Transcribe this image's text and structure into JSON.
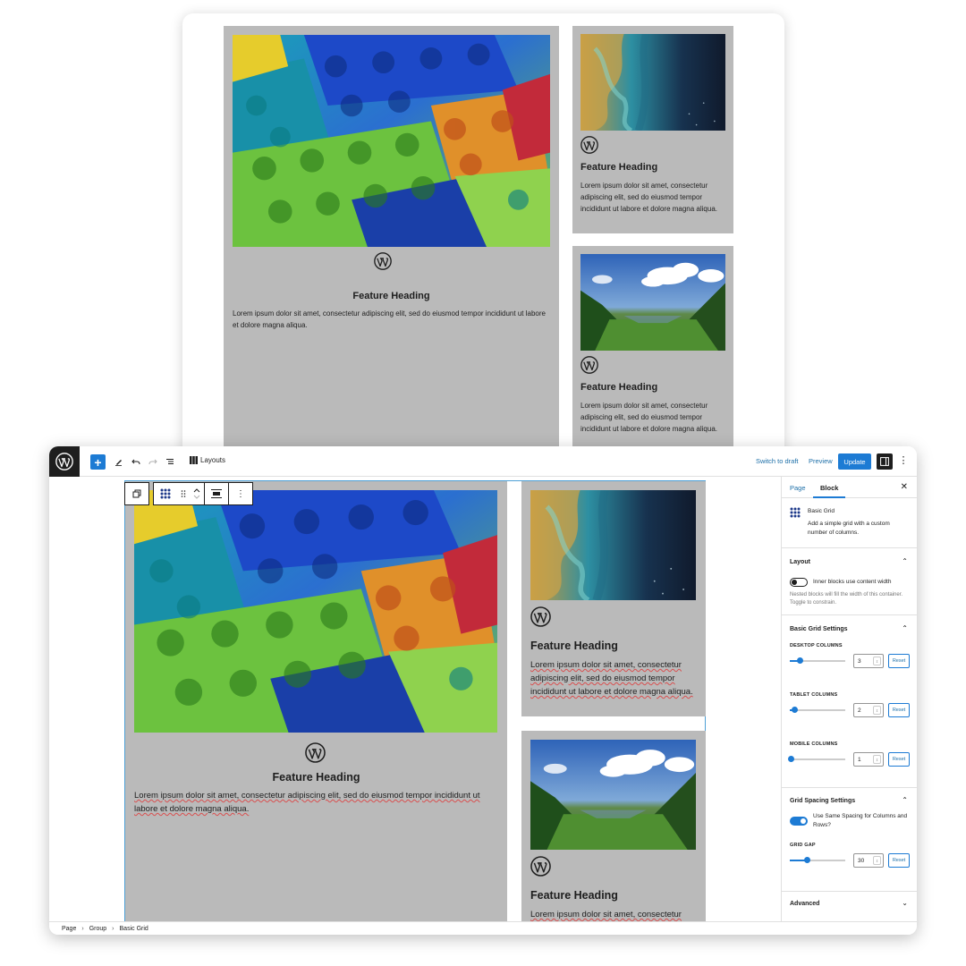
{
  "preview": {
    "main": {
      "heading": "Feature Heading",
      "body": "Lorem ipsum dolor sit amet, consectetur adipiscing elit, sed do eiusmod tempor incididunt ut labore et dolore magna aliqua."
    },
    "side1": {
      "heading": "Feature Heading",
      "body": "Lorem ipsum dolor sit amet, consectetur adipiscing elit, sed do eiusmod tempor incididunt ut labore et dolore magna aliqua."
    },
    "side2": {
      "heading": "Feature Heading",
      "body": "Lorem ipsum dolor sit amet, consectetur adipiscing elit, sed do eiusmod tempor incididunt ut labore et dolore magna aliqua."
    }
  },
  "topbar": {
    "add_label": "+",
    "layouts_label": "Layouts",
    "switch_to_draft": "Switch to draft",
    "preview": "Preview",
    "update": "Update"
  },
  "editor": {
    "main": {
      "heading": "Feature Heading",
      "body": "Lorem ipsum dolor sit amet, consectetur adipiscing elit, sed do eiusmod tempor incididunt ut labore et dolore magna aliqua."
    },
    "side1": {
      "heading": "Feature Heading",
      "body": "Lorem ipsum dolor sit amet, consectetur adipiscing elit, sed do eiusmod tempor incididunt ut labore et dolore magna aliqua."
    },
    "side2": {
      "heading": "Feature Heading",
      "body": "Lorem ipsum dolor sit amet, consectetur"
    }
  },
  "sidebar": {
    "tabs": [
      {
        "label": "Page"
      },
      {
        "label": "Block"
      }
    ],
    "block_name": "Basic Grid",
    "block_description": "Add a simple grid with a custom number of columns.",
    "layout": {
      "title": "Layout",
      "toggle_label": "Inner blocks use content width",
      "toggle_on": false,
      "help": "Nested blocks will fill the width of this container. Toggle to constrain."
    },
    "grid_settings": {
      "title": "Basic Grid Settings",
      "desktop_label": "DESKTOP COLUMNS",
      "desktop_value": "3",
      "tablet_label": "TABLET COLUMNS",
      "tablet_value": "2",
      "mobile_label": "MOBILE COLUMNS",
      "mobile_value": "1",
      "reset": "Reset"
    },
    "spacing": {
      "title": "Grid Spacing Settings",
      "toggle_label": "Use Same Spacing for Columns and Rows?",
      "toggle_on": true,
      "gap_label": "GRID GAP",
      "gap_value": "30",
      "reset": "Reset"
    },
    "advanced": {
      "title": "Advanced"
    }
  },
  "breadcrumb": [
    {
      "label": "Page"
    },
    {
      "label": "Group"
    },
    {
      "label": "Basic Grid"
    }
  ],
  "colors": {
    "accent": "#1d7bd4",
    "tile": "#bababa",
    "dark": "#1e1e1e"
  }
}
